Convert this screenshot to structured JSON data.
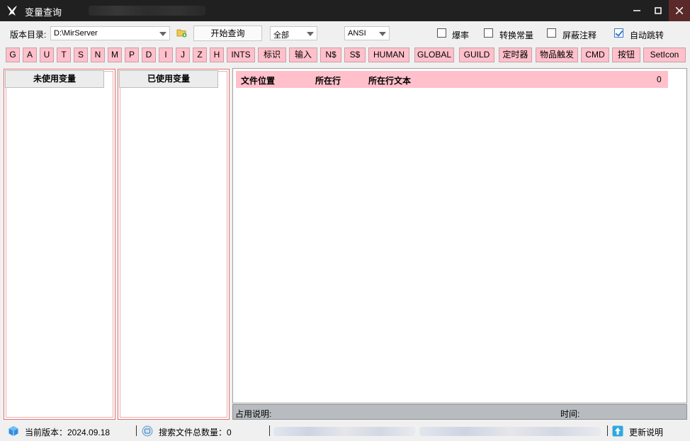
{
  "window": {
    "title": "变量查询",
    "controls": {
      "minimize": "—",
      "maximize": "▢",
      "close": "✕"
    }
  },
  "toolbar": {
    "dir_label": "版本目录:",
    "dir_value": "D:\\MirServer",
    "start_button": "开始查询",
    "scope_select": "全部",
    "encoding_select": "ANSI",
    "checkboxes": [
      {
        "label": "爆率",
        "checked": false
      },
      {
        "label": "转换常量",
        "checked": false
      },
      {
        "label": "屏蔽注释",
        "checked": false
      },
      {
        "label": "自动跳转",
        "checked": true
      }
    ]
  },
  "var_buttons": [
    "G",
    "A",
    "U",
    "T",
    "S",
    "N",
    "M",
    "P",
    "D",
    "I",
    "J",
    "Z",
    "H",
    "INTS",
    "标识",
    "输入",
    "N$",
    "S$",
    "HUMAN",
    "GLOBAL",
    "GUILD",
    "定时器",
    "物品触发",
    "CMD",
    "按钮",
    "SetIcon"
  ],
  "panels": {
    "unused_title": "未使用变量",
    "used_title": "已使用变量"
  },
  "results": {
    "col_file": "文件位置",
    "col_line": "所在行",
    "col_text": "所在行文本",
    "count": "0"
  },
  "info_bar": {
    "usage_label": "占用说明:",
    "time_label": "时间:"
  },
  "statusbar": {
    "version_text": "当前版本：2024.09.18",
    "search_count_text": "搜索文件总数量：0",
    "update_text": "更新说明"
  },
  "colors": {
    "accent_pink": "#ffc0cb",
    "panel_border": "#e07070",
    "titlebar": "#202020",
    "checkbox_accent": "#3a78c8"
  }
}
